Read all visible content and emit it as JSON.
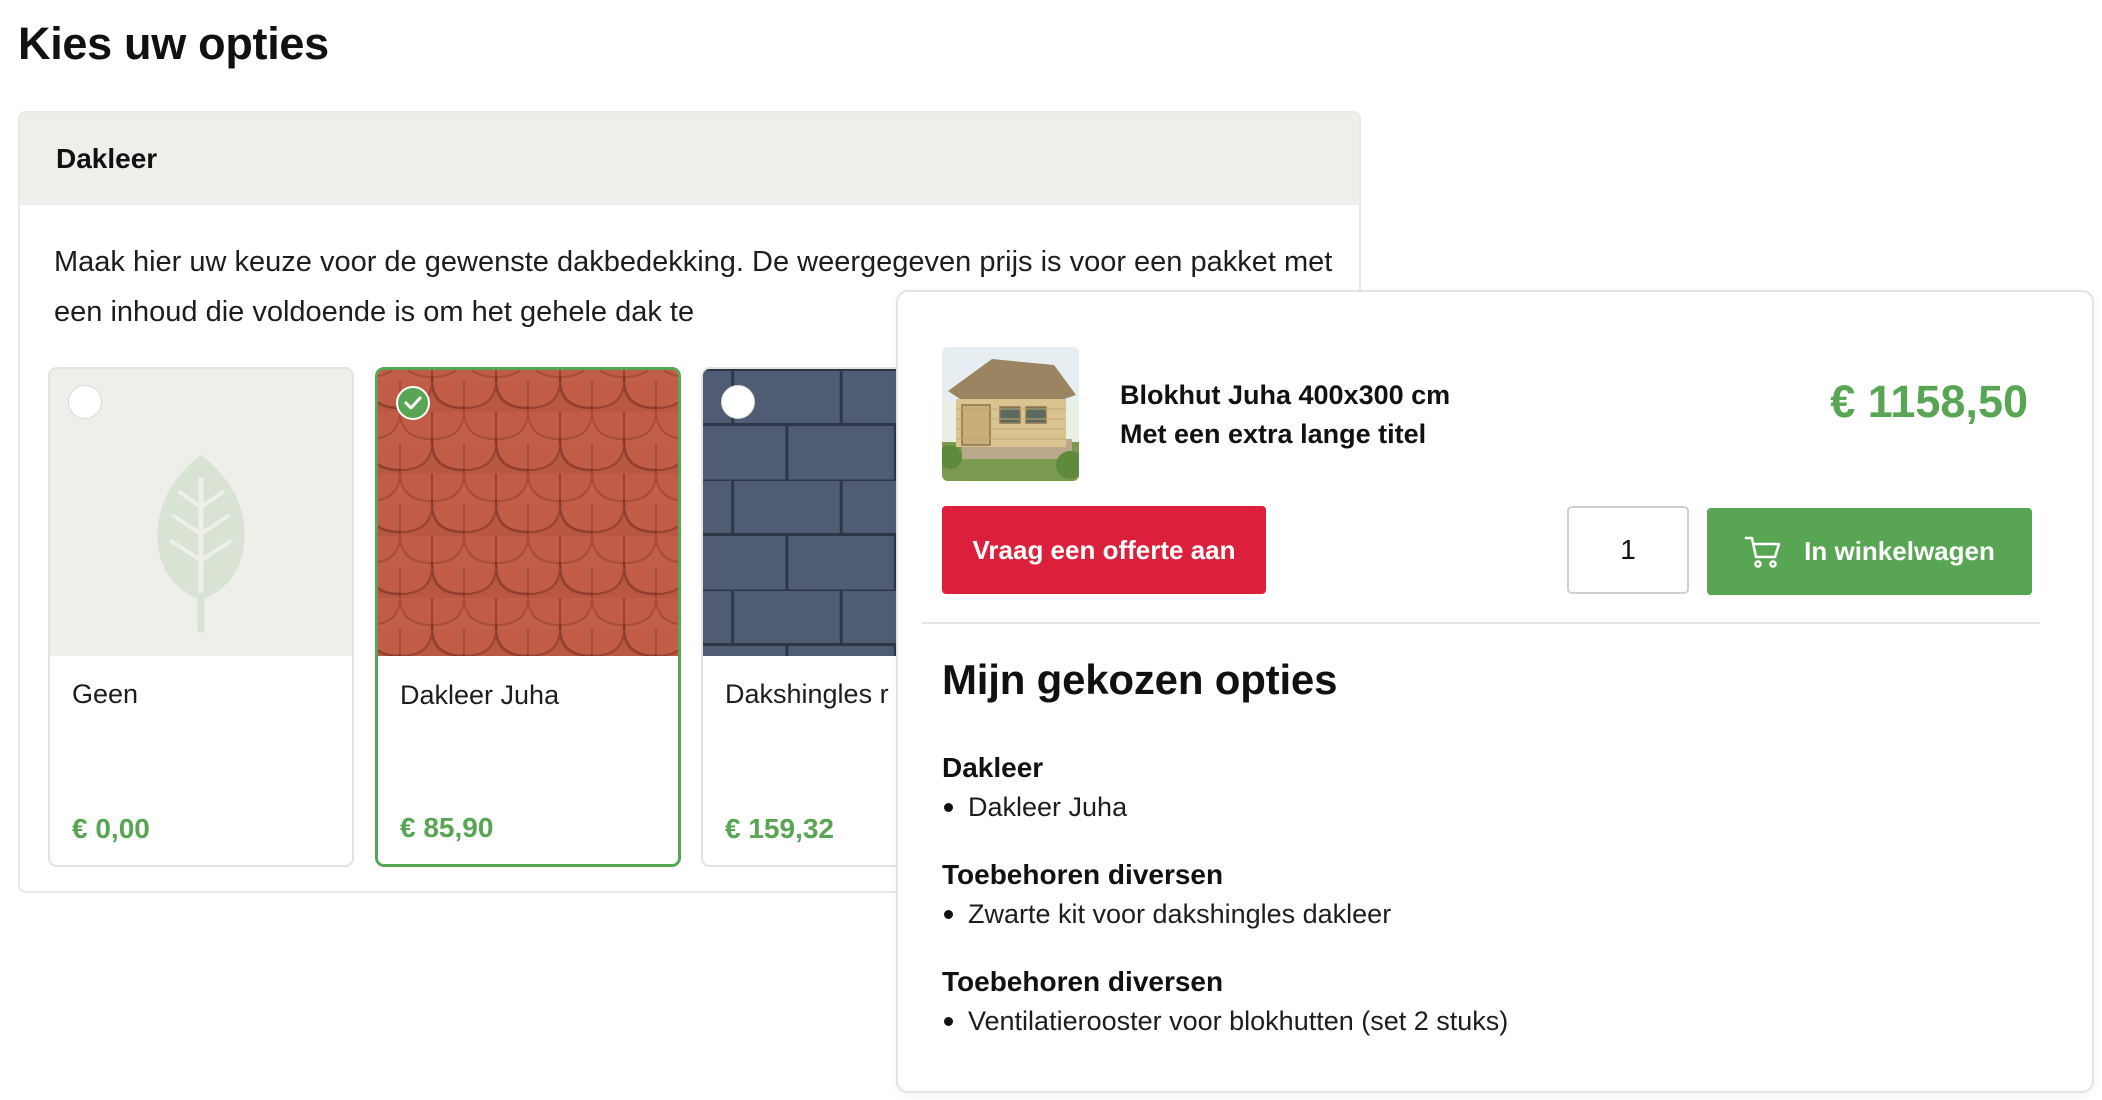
{
  "page": {
    "title": "Kies uw opties"
  },
  "options": {
    "heading": "Dakleer",
    "description": "Maak hier uw keuze voor de gewenste dakbedekking. De weergegeven prijs is voor een pakket met een inhoud die voldoende is om het gehele dak te",
    "cards": [
      {
        "name": "Geen",
        "price": "€ 0,00",
        "selected": false,
        "image": "leaf-placeholder"
      },
      {
        "name": "Dakleer Juha",
        "price": "€ 85,90",
        "selected": true,
        "image": "red-shingle-tiles"
      },
      {
        "name": "Dakshingles r zwart",
        "price": "€ 159,32",
        "selected": false,
        "image": "dark-shingle-tiles"
      }
    ],
    "colors": {
      "accent_green": "#58a553",
      "header_bg": "#eeefea"
    }
  },
  "cart": {
    "product": {
      "title_line1": "Blokhut Juha 400x300 cm",
      "title_line2": "Met een extra lange titel",
      "price": "€ 1158,50",
      "image": "log-cabin-photo"
    },
    "quote_button": "Vraag een offerte aan",
    "quantity": "1",
    "add_button": "In winkelwagen",
    "add_button_icon": "cart-icon",
    "colors": {
      "quote_red": "#dc1f3a",
      "add_green": "#58a553"
    }
  },
  "chosen": {
    "title": "Mijn gekozen opties",
    "groups": [
      {
        "heading": "Dakleer",
        "items": [
          "Dakleer Juha"
        ]
      },
      {
        "heading": "Toebehoren diversen",
        "items": [
          "Zwarte kit voor dakshingles dakleer"
        ]
      },
      {
        "heading": "Toebehoren diversen",
        "items": [
          "Ventilatierooster voor blokhutten (set 2 stuks)"
        ]
      }
    ]
  }
}
